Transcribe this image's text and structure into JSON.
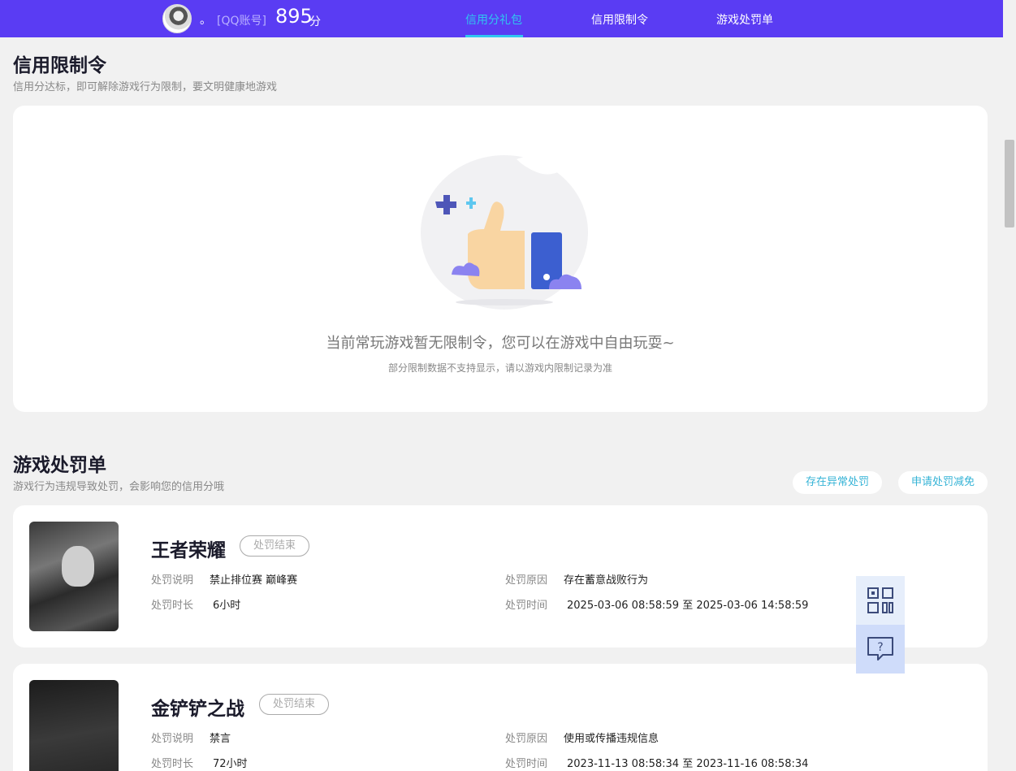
{
  "header": {
    "nickname": "。",
    "account_label": "[QQ账号]",
    "score": "895",
    "score_unit": "分",
    "nav": [
      {
        "label": "信用分礼包",
        "active": true
      },
      {
        "label": "信用限制令",
        "active": false
      },
      {
        "label": "游戏处罚单",
        "active": false
      }
    ]
  },
  "restriction": {
    "title": "信用限制令",
    "subtitle": "信用分达标，即可解除游戏行为限制，要文明健康地游戏",
    "empty_main": "当前常玩游戏暂无限制令，您可以在游戏中自由玩耍~",
    "empty_sub": "部分限制数据不支持显示，请以游戏内限制记录为准"
  },
  "penalty": {
    "title": "游戏处罚单",
    "subtitle": "游戏行为违规导致处罚，会影响您的信用分哦",
    "buttons": {
      "abnormal": "存在异常处罚",
      "reduce": "申请处罚减免"
    },
    "labels": {
      "desc": "处罚说明",
      "duration": "处罚时长",
      "reason": "处罚原因",
      "time": "处罚时间"
    },
    "items": [
      {
        "game": "王者荣耀",
        "status": "处罚结束",
        "desc": "禁止排位赛 巅峰赛",
        "duration": "6小时",
        "reason": "存在蓄意战败行为",
        "time": "2025-03-06 08:58:59 至 2025-03-06 14:58:59"
      },
      {
        "game": "金铲铲之战",
        "status": "处罚结束",
        "desc": "禁言",
        "duration": "72小时",
        "reason": "使用或传播违规信息",
        "time": "2023-11-13 08:58:34 至 2023-11-16 08:58:34"
      }
    ]
  },
  "icons": {
    "qr": "qr-code-icon",
    "help": "help-chat-icon",
    "illustration": "thumbs-up-illustration"
  },
  "colors": {
    "brand": "#5a3cf3",
    "accent": "#30c6f0",
    "link": "#35b3d6"
  }
}
